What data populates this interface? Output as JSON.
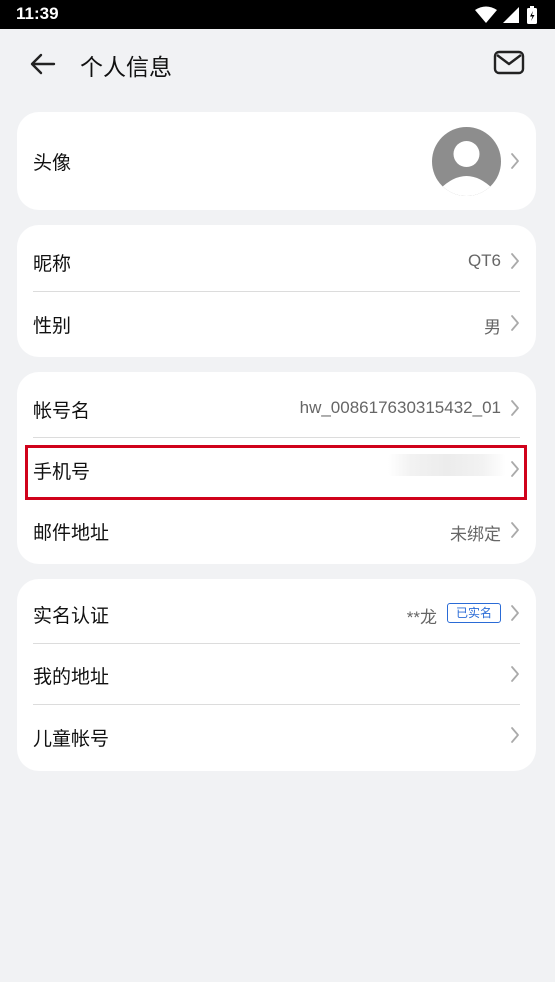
{
  "status_bar": {
    "time": "11:39"
  },
  "header": {
    "title": "个人信息"
  },
  "profile": {
    "avatar_row": {
      "label": "头像"
    }
  },
  "basic_info": {
    "nickname": {
      "label": "昵称",
      "value": "QT6"
    },
    "gender": {
      "label": "性别",
      "value": "男"
    }
  },
  "account": {
    "account_name": {
      "label": "帐号名",
      "value": "hw_008617630315432_01"
    },
    "phone": {
      "label": "手机号"
    },
    "email": {
      "label": "邮件地址",
      "value": "未绑定"
    }
  },
  "other": {
    "real_name": {
      "label": "实名认证",
      "value": "**龙",
      "badge": "已实名"
    },
    "address": {
      "label": "我的地址"
    },
    "child_account": {
      "label": "儿童帐号"
    }
  },
  "colors": {
    "background": "#f1f2f4",
    "card": "#ffffff",
    "highlight": "#d0021b",
    "badge": "#2a6bd6"
  }
}
